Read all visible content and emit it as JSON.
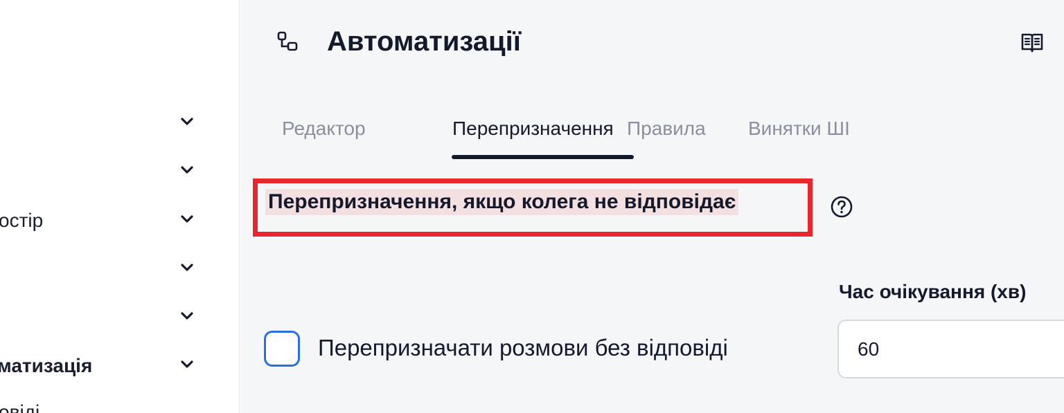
{
  "sidebar": {
    "items": [
      {
        "label": "",
        "bold": false
      },
      {
        "label": "",
        "bold": false
      },
      {
        "label": "остір",
        "bold": false
      },
      {
        "label": "",
        "bold": false
      },
      {
        "label": "",
        "bold": false
      },
      {
        "label": "матизація",
        "bold": true
      },
      {
        "label": "овіді",
        "bold": false
      }
    ]
  },
  "header": {
    "title": "Автоматизації"
  },
  "tabs": [
    {
      "label": "Редактор",
      "active": false
    },
    {
      "label": "Перепризначення",
      "active": true
    },
    {
      "label": "Правила",
      "active": false
    },
    {
      "label": "Винятки ШІ",
      "active": false
    }
  ],
  "section": {
    "title": "Перепризначення, якщо колега не відповідає"
  },
  "form": {
    "checkbox_label": "Перепризначати розмови без відповіді",
    "checkbox_checked": false,
    "wait_label": "Час очікування (хв)",
    "wait_value": "60"
  },
  "colors": {
    "accent": "#2a6fe0",
    "highlight_border": "#e8262d",
    "text_dark": "#141a2b",
    "tab_inactive": "#8a8f9c",
    "main_bg": "#f5f6f8"
  }
}
